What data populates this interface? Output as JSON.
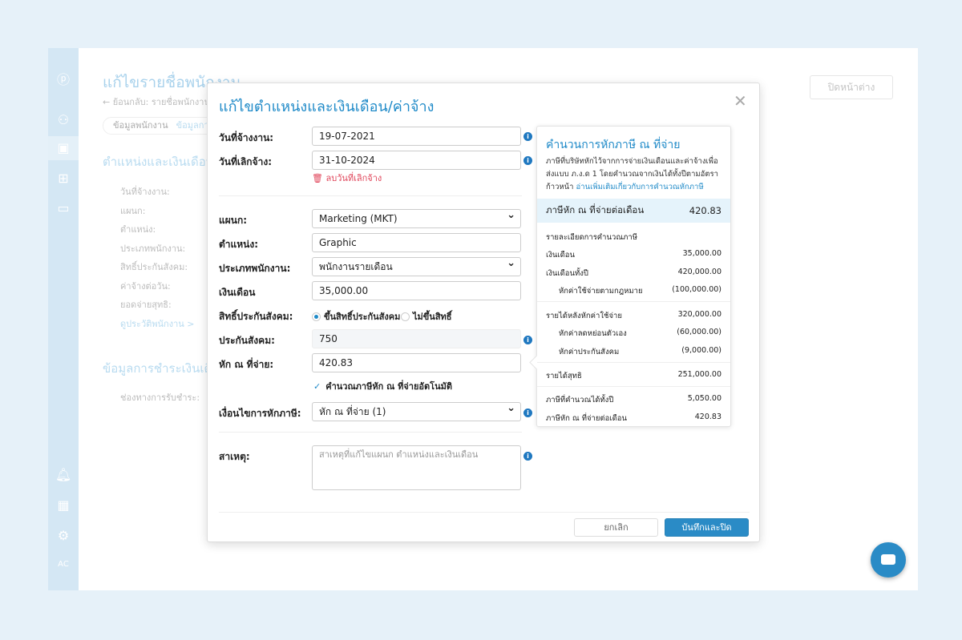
{
  "background": {
    "page_title": "แก้ไขรายชื่อพนักงาน",
    "back_link": "← ย้อนกลับ: รายชื่อพนักงาน",
    "tabs": [
      "ข้อมูลพนักงาน",
      "ข้อมูลการจ้าง"
    ],
    "section1": "ตำแหน่งและเงินเดือน/ค่าจ้าง",
    "labels": [
      "วันที่จ้างงาน:",
      "แผนก:",
      "ตำแหน่ง:",
      "ประเภทพนักงาน:",
      "สิทธิ์ประกันสังคม:",
      "ค่าจ้างต่อวัน:",
      "ยอดจ่ายสุทธิ:"
    ],
    "history_link": "ดูประวัติพนักงาน >",
    "section2": "ข้อมูลการชำระเงินเดือน",
    "payment_label": "ช่องทางการรับชำระ:",
    "close_window": "ปิดหน้าต่าง",
    "avatar_initials": "AC"
  },
  "modal": {
    "title": "แก้ไขตำแหน่งและเงินเดือน/ค่าจ้าง",
    "close": "✕",
    "fields": {
      "hire_date": {
        "label": "วันที่จ้างงาน:",
        "value": "19-07-2021"
      },
      "end_date": {
        "label": "วันที่เลิกจ้าง:",
        "value": "31-10-2024"
      },
      "delete_end_date": "ลบวันที่เลิกจ้าง",
      "department": {
        "label": "แผนก:",
        "value": "Marketing (MKT)"
      },
      "position": {
        "label": "ตำแหน่ง:",
        "value": "Graphic"
      },
      "employee_type": {
        "label": "ประเภทพนักงาน:",
        "value": "พนักงานรายเดือน"
      },
      "salary": {
        "label": "เงินเดือน",
        "value": "35,000.00"
      },
      "social_security_right": {
        "label": "สิทธิ์ประกันสังคม:",
        "options": [
          "ขึ้นสิทธิ์ประกันสังคม",
          "ไม่ขึ้นสิทธิ์"
        ],
        "selected": "ขึ้นสิทธิ์ประกันสังคม"
      },
      "social_security": {
        "label": "ประกันสังคม:",
        "value": "750"
      },
      "withholding": {
        "label": "หัก ณ ที่จ่าย:",
        "value": "420.83"
      },
      "auto_calc": {
        "label": "คำนวณภาษีหัก ณ ที่จ่ายอัตโนมัติ",
        "checked": true
      },
      "tax_condition": {
        "label": "เงื่อนไขการหักภาษี:",
        "value": "หัก ณ ที่จ่าย (1)"
      },
      "reason": {
        "label": "สาเหตุ:",
        "placeholder": "สาเหตุที่แก้ไขแผนก ตำแหน่งและเงินเดือน"
      }
    },
    "cancel": "ยกเลิก",
    "save": "บันทึกและปิด"
  },
  "tax_panel": {
    "title": "คำนวนการหักภาษี ณ ที่จ่าย",
    "description": "ภาษีที่บริษัทหักไว้จากการจ่ายเงินเดือนและค่าจ้างเพื่อส่งแบบ ภ.ง.ด 1 โดยคำนวณจากเงินได้ทั้งปีตามอัตราก้าวหน้า",
    "read_more": "อ่านเพิ่มเติมเกี่ยวกับการคำนวณหักภาษี",
    "highlight": {
      "label": "ภาษีหัก ณ ที่จ่ายต่อเดือน",
      "value": "420.83"
    },
    "details_title": "รายละเอียดการคำนวณภาษี",
    "rows": [
      {
        "label": "เงินเดือน",
        "value": "35,000.00"
      },
      {
        "label": "เงินเดือนทั้งปี",
        "value": "420,000.00"
      },
      {
        "label": "หักค่าใช้จ่ายตามกฎหมาย",
        "value": "(100,000.00)"
      },
      {
        "label": "รายได้หลังหักค่าใช้จ่าย",
        "value": "320,000.00"
      },
      {
        "label": "หักค่าลดหย่อนตัวเอง",
        "value": "(60,000.00)"
      },
      {
        "label": "หักค่าประกันสังคม",
        "value": "(9,000.00)"
      },
      {
        "label": "รายได้สุทธิ",
        "value": "251,000.00"
      },
      {
        "label": "ภาษีที่คำนวณได้ทั้งปี",
        "value": "5,050.00"
      },
      {
        "label": "ภาษีหัก ณ ที่จ่ายต่อเดือน",
        "value": "420.83"
      }
    ]
  },
  "colors": {
    "accent": "#2a8bc6",
    "danger": "#e0455a",
    "highlight": "#e5f3fb"
  }
}
